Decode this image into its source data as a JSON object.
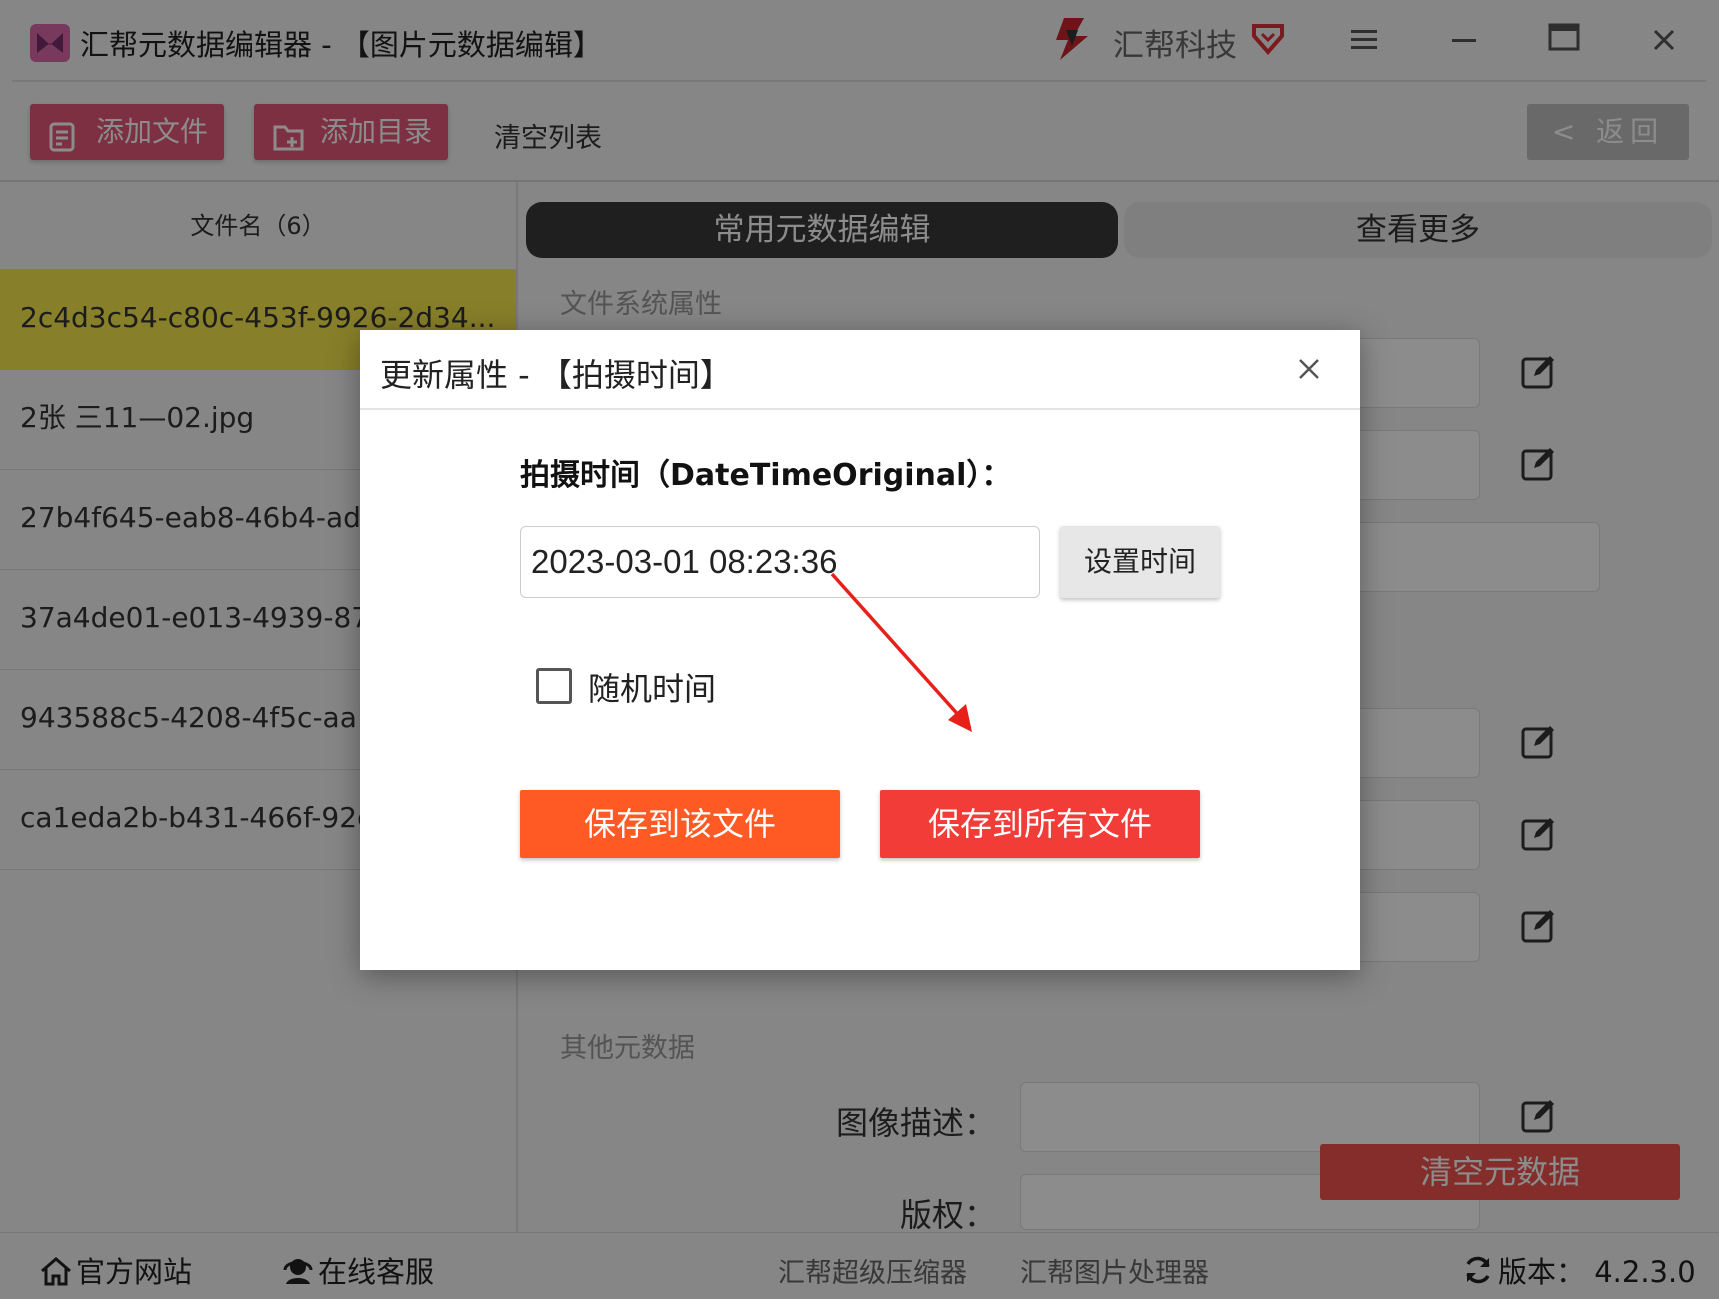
{
  "titlebar": {
    "app_title": "汇帮元数据编辑器 - 【图片元数据编辑】",
    "brand": "汇帮科技",
    "menu_icon": "menu-icon",
    "minimize_icon": "minimize-icon",
    "maximize_icon": "maximize-icon",
    "close_icon": "close-icon"
  },
  "toolbar": {
    "add_file": "添加文件",
    "add_folder": "添加目录",
    "clear_list": "清空列表",
    "back": "< 返回"
  },
  "filelist": {
    "header": "文件名（6）",
    "files": [
      "2c4d3c54-c80c-453f-9926-2d34...",
      "2张 三11—02.jpg",
      "27b4f645-eab8-46b4-ad7",
      "37a4de01-e013-4939-87a",
      "943588c5-4208-4f5c-aa1a",
      "ca1eda2b-b431-466f-92c"
    ]
  },
  "tabs": {
    "common": "常用元数据编辑",
    "more": "查看更多"
  },
  "sections": {
    "filesystem": "文件系统属性",
    "other": "其他元数据"
  },
  "fields": {
    "image_description": "图像描述：",
    "copyright": "版权："
  },
  "clear_metadata": "清空元数据",
  "footer": {
    "website": "官方网站",
    "support": "在线客服",
    "compressor": "汇帮超级压缩器",
    "image_processor": "汇帮图片处理器",
    "version": "版本：  4.2.3.0"
  },
  "dialog": {
    "title": "更新属性 - 【拍摄时间】",
    "label": "拍摄时间（DateTimeOriginal）：",
    "datetime_value": "2023-03-01 08:23:36",
    "set_time": "设置时间",
    "random_time": "随机时间",
    "random_checked": false,
    "save_this": "保存到该文件",
    "save_all": "保存到所有文件"
  },
  "colors": {
    "accent_pink": "#e6587a",
    "selected_row": "#f6e84c",
    "save_one": "#ff5a24",
    "save_all": "#f23c38",
    "arrow": "#e8201a"
  }
}
